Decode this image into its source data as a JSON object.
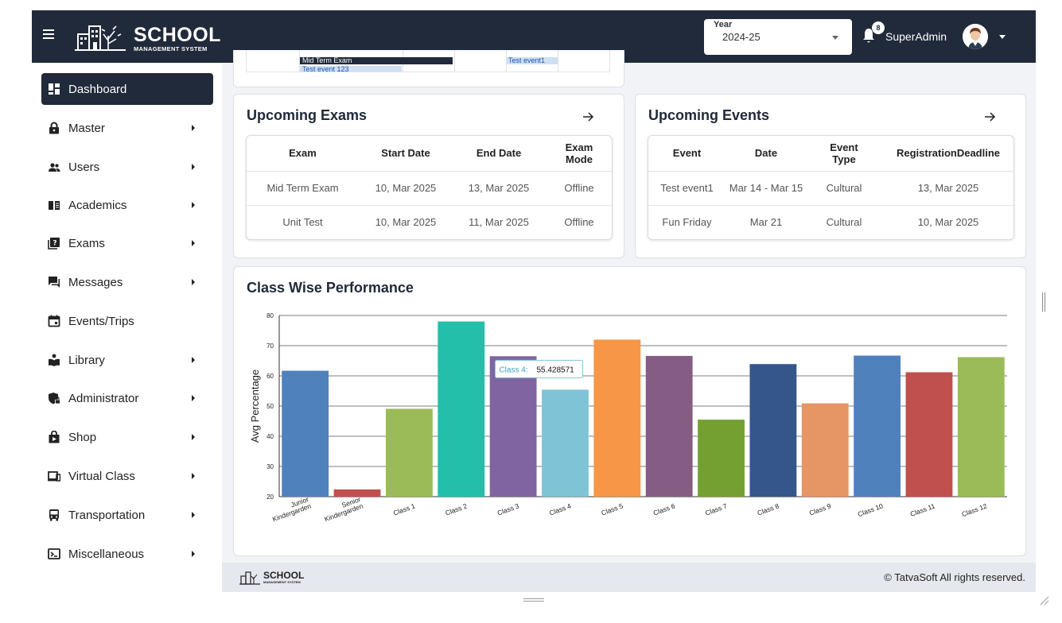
{
  "header": {
    "logo_text": "SCHOOL",
    "logo_subtext": "MANAGEMENT SYSTEM",
    "year_label": "Year",
    "year_value": "2024-25",
    "notification_count": "8",
    "username": "SuperAdmin"
  },
  "sidebar": {
    "items": [
      {
        "label": "Dashboard",
        "icon": "dashboard-icon",
        "active": true,
        "expandable": false
      },
      {
        "label": "Master",
        "icon": "lock-icon",
        "expandable": true
      },
      {
        "label": "Users",
        "icon": "users-icon",
        "expandable": true
      },
      {
        "label": "Academics",
        "icon": "book-icon",
        "expandable": true
      },
      {
        "label": "Exams",
        "icon": "exam-icon",
        "expandable": true
      },
      {
        "label": "Messages",
        "icon": "message-icon",
        "expandable": true
      },
      {
        "label": "Events/Trips",
        "icon": "calendar-icon",
        "expandable": false
      },
      {
        "label": "Library",
        "icon": "reader-icon",
        "expandable": true
      },
      {
        "label": "Administrator",
        "icon": "shield-lock-icon",
        "expandable": true
      },
      {
        "label": "Shop",
        "icon": "shop-bag-icon",
        "expandable": true
      },
      {
        "label": "Virtual Class",
        "icon": "laptop-icon",
        "expandable": true
      },
      {
        "label": "Transportation",
        "icon": "bus-icon",
        "expandable": true
      },
      {
        "label": "Miscellaneous",
        "icon": "terminal-icon",
        "expandable": true
      }
    ]
  },
  "calendar_peek": {
    "items": [
      "Mid Term Exam",
      "Test event1",
      "Test event 123"
    ]
  },
  "upcoming_exams": {
    "title": "Upcoming Exams",
    "columns": [
      "Exam",
      "Start Date",
      "End Date",
      "Exam Mode"
    ],
    "rows": [
      [
        "Mid Term Exam",
        "10, Mar 2025",
        "13, Mar 2025",
        "Offline"
      ],
      [
        "Unit Test",
        "10, Mar 2025",
        "11, Mar 2025",
        "Offline"
      ]
    ]
  },
  "upcoming_events": {
    "title": "Upcoming Events",
    "columns": [
      "Event",
      "Date",
      "Event Type",
      "RegistrationDeadline"
    ],
    "rows": [
      [
        "Test event1",
        "Mar 14 - Mar 15",
        "Cultural",
        "13, Mar 2025"
      ],
      [
        "Fun Friday",
        "Mar 21",
        "Cultural",
        "10, Mar 2025"
      ]
    ]
  },
  "performance": {
    "title": "Class Wise Performance",
    "tooltip": {
      "label": "Class 4:",
      "value": "55.428571"
    }
  },
  "chart_data": {
    "type": "bar",
    "title": "Class Wise Performance",
    "ylabel": "Avg Percentage",
    "ylim": [
      20,
      80
    ],
    "yticks": [
      20,
      30,
      40,
      50,
      60,
      70,
      80
    ],
    "grid": true,
    "categories": [
      "Junior\nKindergarden",
      "Senior\nKindergarden",
      "Class 1",
      "Class 2",
      "Class 3",
      "Class 4",
      "Class 5",
      "Class 6",
      "Class 7",
      "Class 8",
      "Class 9",
      "Class 10",
      "Class 11",
      "Class 12"
    ],
    "values": [
      61.7,
      22.4,
      49.1,
      78.0,
      66.5,
      55.428571,
      72.0,
      66.6,
      45.5,
      63.9,
      50.9,
      66.7,
      61.2,
      66.2
    ],
    "colors": [
      "#4f81bd",
      "#c0504d",
      "#9bbb59",
      "#23bfaa",
      "#8064a2",
      "#7fc4d6",
      "#f79646",
      "#855c84",
      "#74a032",
      "#34568b",
      "#e69565",
      "#4f81bd",
      "#c0504d",
      "#9bbb59"
    ]
  },
  "footer": {
    "logo_text": "SCHOOL",
    "logo_subtext": "MANAGEMENT SYSTEM",
    "copyright": "© TatvaSoft All rights reserved."
  },
  "colors": {
    "header_bg": "#212a3a",
    "sidebar_active": "#212a3a",
    "content_bg": "#f1f3f7",
    "footer_bg": "#e6e8ef"
  }
}
